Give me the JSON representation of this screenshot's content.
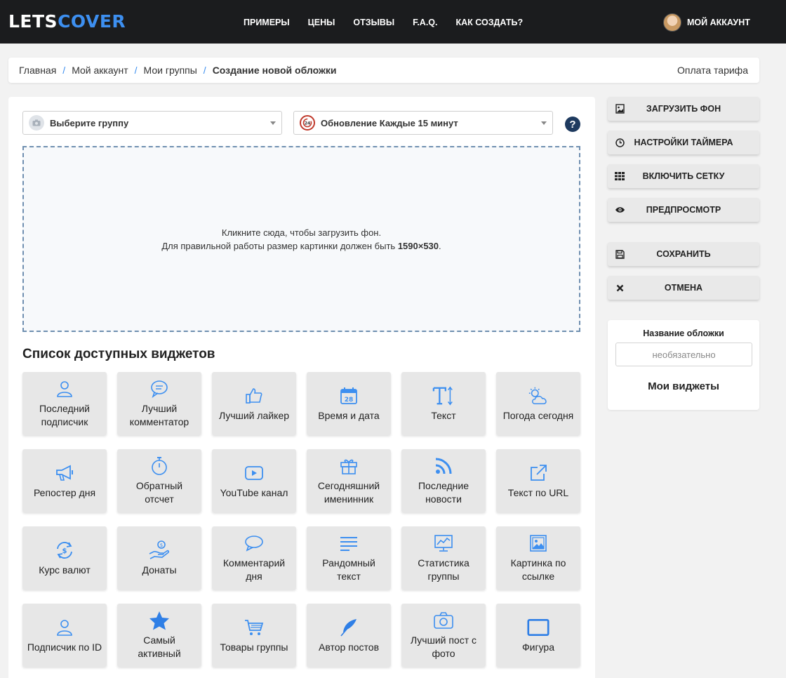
{
  "brand": {
    "part1": "LETS",
    "part2": "COVER"
  },
  "nav": {
    "links": [
      "ПРИМЕРЫ",
      "ЦЕНЫ",
      "ОТЗЫВЫ",
      "F.A.Q.",
      "КАК СОЗДАТЬ?"
    ],
    "account": "МОЙ АККАУНТ"
  },
  "breadcrumb": {
    "items": [
      "Главная",
      "Мой аккаунт",
      "Мои группы"
    ],
    "current": "Создание новой обложки",
    "separator": "/",
    "pay": "Оплата тарифа"
  },
  "selects": {
    "group": "Выберите группу",
    "update": "Обновление Каждые 15 минут",
    "help": "?"
  },
  "dropzone": {
    "line1": "Кликните сюда, чтобы загрузить фон.",
    "line2": "Для правильной работы размер картинки должен быть ",
    "size": "1590×530",
    "end": "."
  },
  "widgets_title": "Список доступных виджетов",
  "widgets": [
    {
      "label": "Последний подписчик",
      "icon": "user-icon"
    },
    {
      "label": "Лучший комментатор",
      "icon": "chat-bubble-icon"
    },
    {
      "label": "Лучший лайкер",
      "icon": "thumbs-up-icon"
    },
    {
      "label": "Время и дата",
      "icon": "calendar-icon"
    },
    {
      "label": "Текст",
      "icon": "text-icon"
    },
    {
      "label": "Погода сегодня",
      "icon": "weather-icon"
    },
    {
      "label": "Репостер дня",
      "icon": "megaphone-icon"
    },
    {
      "label": "Обратный отсчет",
      "icon": "stopwatch-icon"
    },
    {
      "label": "YouTube канал",
      "icon": "youtube-icon"
    },
    {
      "label": "Сегодняшний именинник",
      "icon": "gift-icon"
    },
    {
      "label": "Последние новости",
      "icon": "rss-icon"
    },
    {
      "label": "Текст по URL",
      "icon": "external-link-icon"
    },
    {
      "label": "Курс валют",
      "icon": "currency-exchange-icon"
    },
    {
      "label": "Донаты",
      "icon": "donate-hand-icon"
    },
    {
      "label": "Комментарий дня",
      "icon": "comment-icon"
    },
    {
      "label": "Рандомный текст",
      "icon": "text-lines-icon"
    },
    {
      "label": "Статистика группы",
      "icon": "statistics-icon"
    },
    {
      "label": "Картинка по ссылке",
      "icon": "image-icon"
    },
    {
      "label": "Подписчик по ID",
      "icon": "user-id-icon"
    },
    {
      "label": "Самый активный",
      "icon": "star-icon"
    },
    {
      "label": "Товары группы",
      "icon": "cart-icon"
    },
    {
      "label": "Автор постов",
      "icon": "feather-icon"
    },
    {
      "label": "Лучший пост с фото",
      "icon": "camera-icon"
    },
    {
      "label": "Фигура",
      "icon": "rectangle-icon"
    }
  ],
  "side_buttons": [
    {
      "label": "ЗАГРУЗИТЬ ФОН",
      "icon": "image-upload-icon"
    },
    {
      "label": "НАСТРОЙКИ ТАЙМЕРА",
      "icon": "clock-icon"
    },
    {
      "label": "ВКЛЮЧИТЬ СЕТКУ",
      "icon": "grid-icon"
    },
    {
      "label": "ПРЕДПРОСМОТР",
      "icon": "eye-icon"
    },
    {
      "label": "СОХРАНИТЬ",
      "icon": "floppy-disk-icon"
    },
    {
      "label": "ОТМЕНА",
      "icon": "close-icon"
    }
  ],
  "cover": {
    "label": "Название обложки",
    "placeholder": "необязательно",
    "value": "",
    "my_widgets": "Мои виджеты"
  },
  "colors": {
    "accent": "#3d8ff0",
    "nav_bg": "#1b1c1e",
    "icon_blue": "#3d8ff0"
  }
}
